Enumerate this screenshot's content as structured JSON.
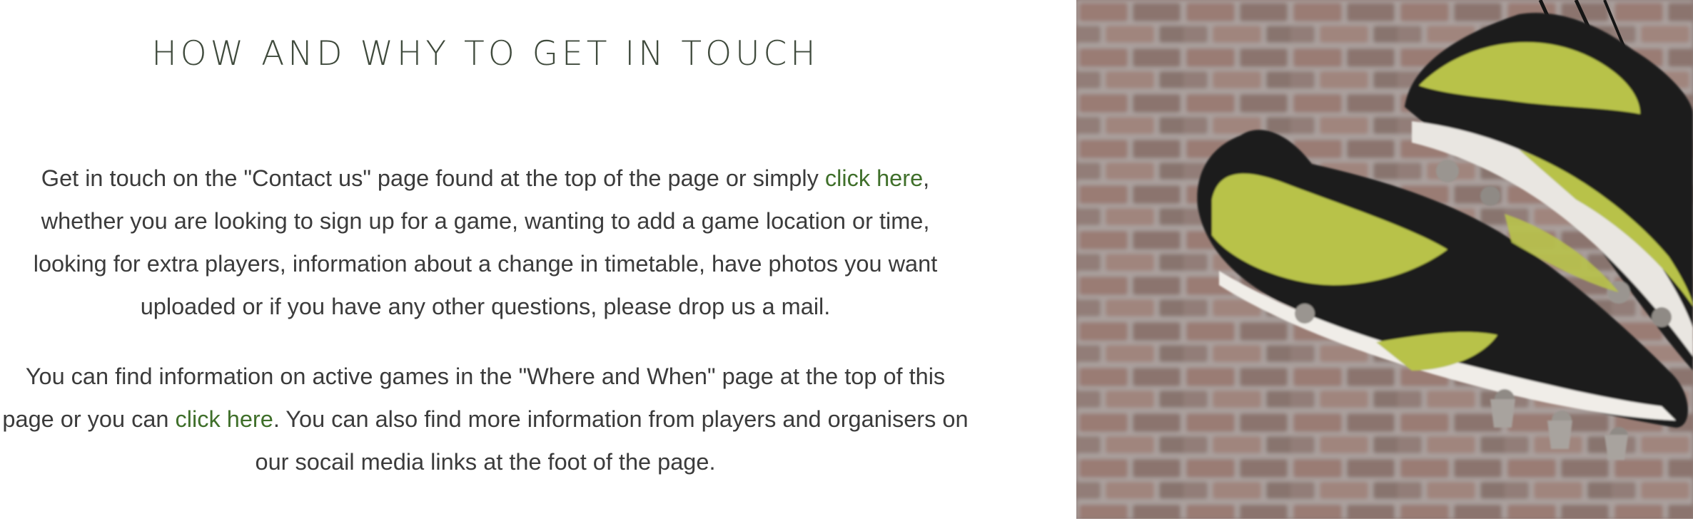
{
  "section": {
    "heading": "HOW AND WHY TO GET IN TOUCH",
    "paragraph1": {
      "text_before": "Get in touch on the \"Contact us\" page found at the top of the page or simply ",
      "link": "click here",
      "text_after": ", whether you are looking to sign up for a game, wanting to add a game location or time, looking for extra players, information about a change in timetable, have photos you want uploaded or if you have any other questions, please drop us a mail."
    },
    "paragraph2": {
      "text_before": "You can find information on active games in the \"Where and When\" page at the top of this page or you can ",
      "link": "click here",
      "text_after": ". You can also find more information from players and organisers on our socail media links at the foot of the page."
    }
  },
  "image": {
    "subject": "football-boots-on-brick-wall",
    "colors": {
      "brick": "#9a7d76",
      "mortar": "#b7b0ae",
      "boot_black": "#1f1f1f",
      "boot_lime": "#b8c24a"
    }
  },
  "colors": {
    "heading": "#3f4a3c",
    "body_text": "#3b3b3b",
    "link": "#3f6f2a",
    "background": "#ffffff"
  }
}
